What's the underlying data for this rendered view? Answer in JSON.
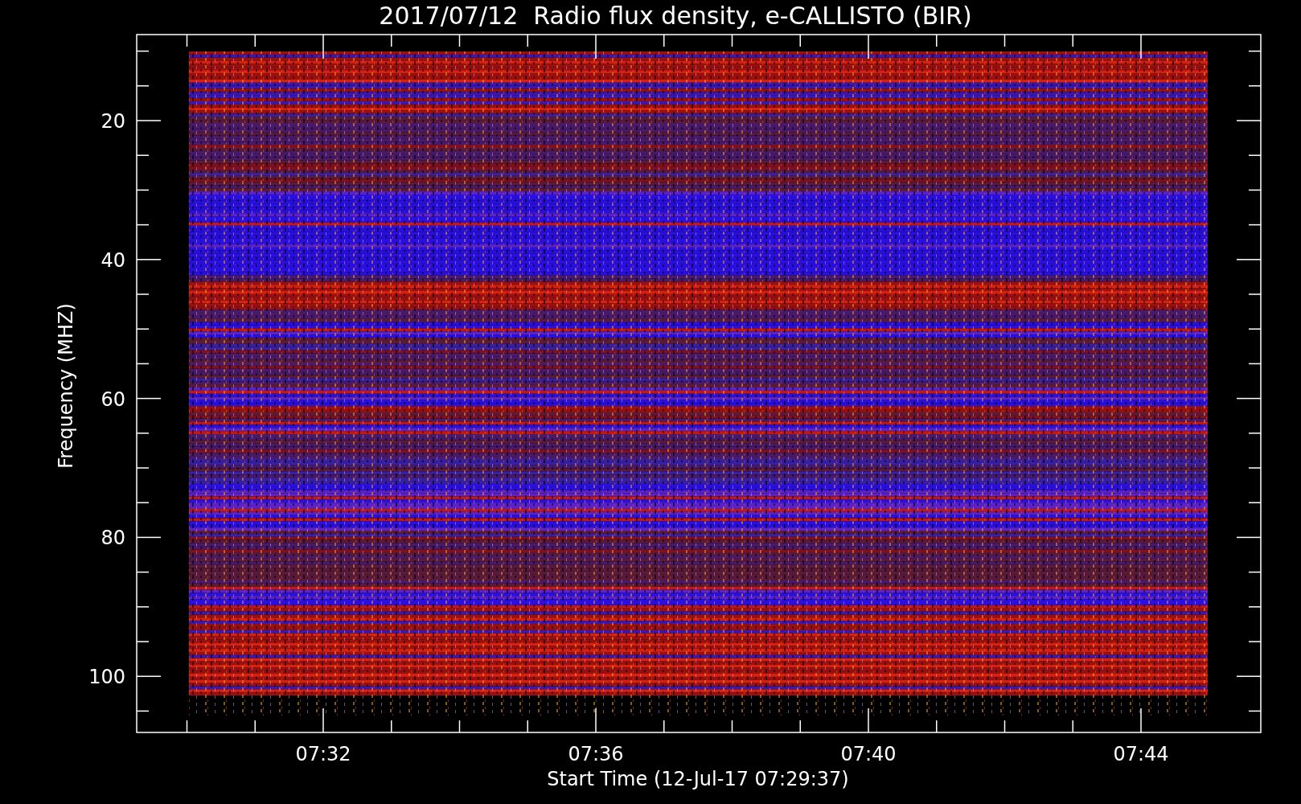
{
  "title": "2017/07/12  Radio flux density, e-CALLISTO (BIR)",
  "y_axis": {
    "label": "Frequency (MHZ)",
    "ticks": [
      "20",
      "40",
      "60",
      "80",
      "100"
    ]
  },
  "x_axis": {
    "label": "Start Time (12-Jul-17 07:29:37)",
    "ticks": [
      "07:32",
      "07:36",
      "07:40",
      "07:44"
    ]
  }
}
